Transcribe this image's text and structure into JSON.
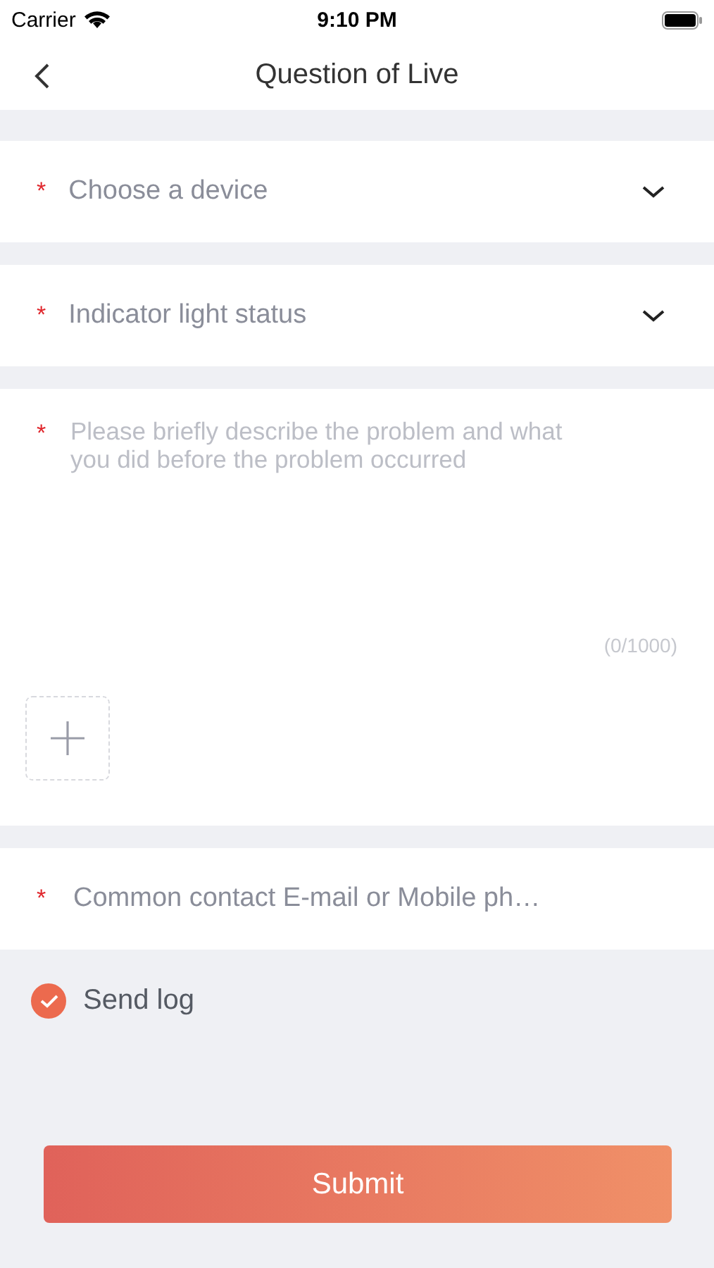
{
  "status_bar": {
    "carrier": "Carrier",
    "time": "9:10 PM"
  },
  "nav": {
    "title": "Question of Live"
  },
  "selects": [
    {
      "required_mark": "*",
      "placeholder": "Choose a device"
    },
    {
      "required_mark": "*",
      "placeholder": "Indicator light status"
    }
  ],
  "description": {
    "required_mark": "*",
    "placeholder": "Please briefly describe the problem and what you did before the problem occurred",
    "counter": "(0/1000)"
  },
  "contact": {
    "required_mark": "*",
    "placeholder": "Common contact E-mail or Mobile ph…"
  },
  "send_log": {
    "label": "Send log",
    "checked": true
  },
  "submit": {
    "label": "Submit"
  }
}
